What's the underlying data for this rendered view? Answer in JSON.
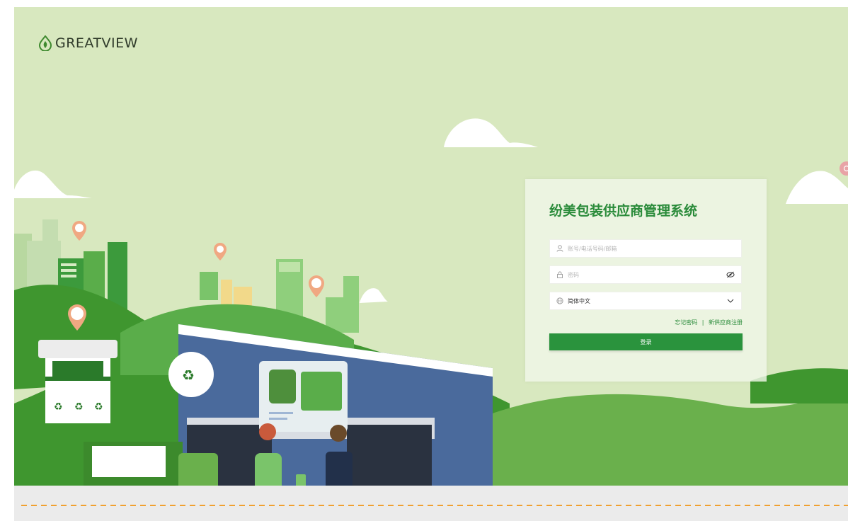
{
  "brand": {
    "logo_text": "GREATVIEW",
    "accent": "#2a933d",
    "logo_leaf_color": "#3f8a2f"
  },
  "login": {
    "title": "纷美包装供应商管理系统",
    "account_placeholder": "账号/电话号码/邮箱",
    "password_placeholder": "密码",
    "language_value": "简体中文",
    "forgot_password": "忘记密码",
    "separator": "|",
    "register": "新供应商注册",
    "submit_label": "登录"
  },
  "icons": {
    "account": "user-icon",
    "password": "lock-icon",
    "password_toggle": "eye-off-icon",
    "language": "globe-icon",
    "dropdown": "chevron-down-icon",
    "float_button": "floating-helper-icon"
  },
  "colors": {
    "sky": "#d8e8bf",
    "hill_light": "#6ab04c",
    "hill_dark": "#3f962f",
    "building": "#4a6a9c",
    "road": "#ebebeb",
    "road_line": "#f0a030"
  }
}
